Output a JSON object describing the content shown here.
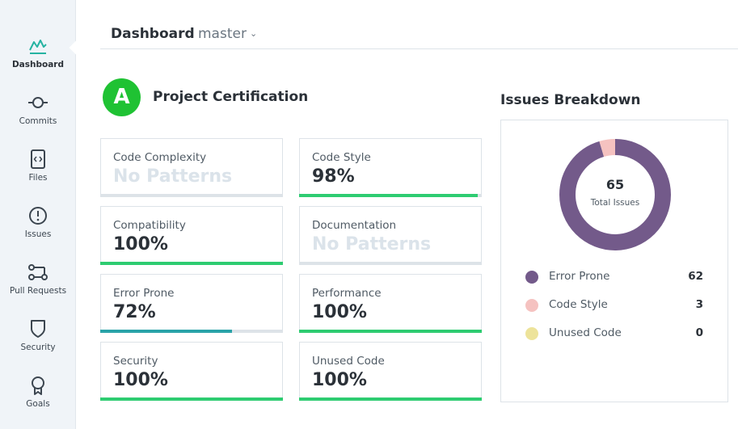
{
  "sidebar": {
    "items": [
      {
        "label": "Dashboard",
        "icon": "dashboard-icon",
        "active": true
      },
      {
        "label": "Commits",
        "icon": "commit-icon"
      },
      {
        "label": "Files",
        "icon": "file-code-icon"
      },
      {
        "label": "Issues",
        "icon": "alert-circle-icon"
      },
      {
        "label": "Pull Requests",
        "icon": "pull-request-icon"
      },
      {
        "label": "Security",
        "icon": "shield-icon"
      },
      {
        "label": "Goals",
        "icon": "award-icon"
      }
    ]
  },
  "header": {
    "title": "Dashboard",
    "branch": "master",
    "branch_chevron": "⌄"
  },
  "certification": {
    "grade": "A",
    "title": "Project Certification"
  },
  "metrics": [
    {
      "label": "Code Complexity",
      "value": "No Patterns",
      "progress": null
    },
    {
      "label": "Code Style",
      "value": "98%",
      "progress": 0.98
    },
    {
      "label": "Compatibility",
      "value": "100%",
      "progress": 1.0
    },
    {
      "label": "Documentation",
      "value": "No Patterns",
      "progress": null
    },
    {
      "label": "Error Prone",
      "value": "72%",
      "progress": 0.72
    },
    {
      "label": "Performance",
      "value": "100%",
      "progress": 1.0
    },
    {
      "label": "Security",
      "value": "100%",
      "progress": 1.0
    },
    {
      "label": "Unused Code",
      "value": "100%",
      "progress": 1.0
    }
  ],
  "issues": {
    "title": "Issues Breakdown",
    "total": "65",
    "caption": "Total Issues",
    "breakdown": [
      {
        "label": "Error Prone",
        "count": "62",
        "color": "#735a8a"
      },
      {
        "label": "Code Style",
        "count": "3",
        "color": "#f5c2c0"
      },
      {
        "label": "Unused Code",
        "count": "0",
        "color": "#ede39a"
      }
    ]
  },
  "colors": {
    "accent": "#26b3a2",
    "good": "#2ecc71",
    "mid": "#2aa3a8",
    "grade": "#1fc233"
  }
}
